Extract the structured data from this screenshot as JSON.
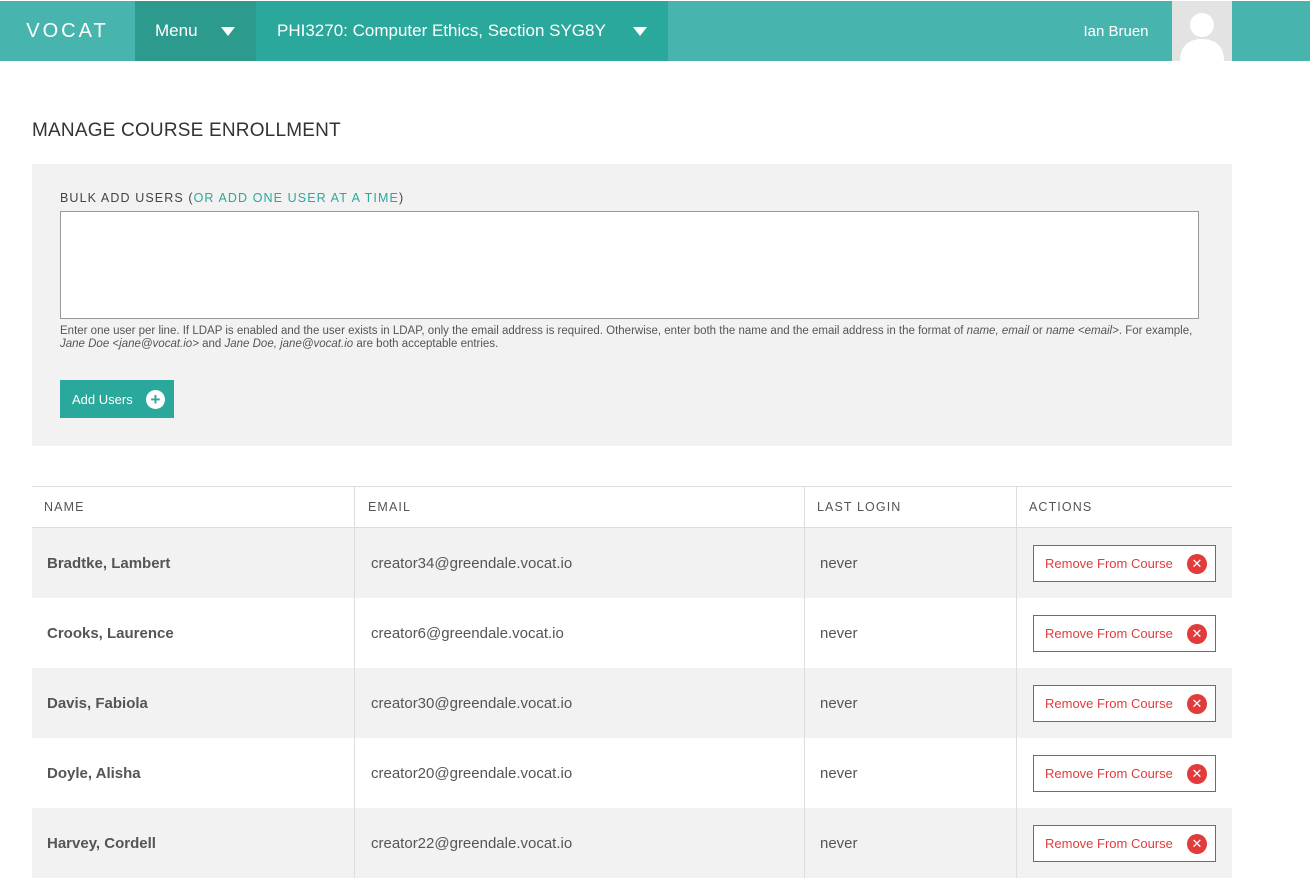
{
  "header": {
    "logo": "VOCAT",
    "menu_label": "Menu",
    "course_label": "PHI3270: Computer Ethics, Section SYG8Y",
    "user_name": "Ian Bruen"
  },
  "page": {
    "title": "MANAGE COURSE ENROLLMENT"
  },
  "bulk_add": {
    "label_prefix": "BULK ADD USERS (",
    "label_link": "OR ADD ONE USER AT A TIME",
    "label_suffix": ")",
    "textarea_value": "",
    "help_1": "Enter one user per line. If LDAP is enabled and the user exists in LDAP, only the email address is required. Otherwise, enter both the name and the email address in the format of ",
    "help_fmt_1": "name, email",
    "help_or": " or ",
    "help_fmt_2": "name <email>",
    "help_2": ". For example, ",
    "help_ex_1": "Jane Doe <jane@vocat.io>",
    "help_and": " and ",
    "help_ex_2": "Jane Doe, jane@vocat.io",
    "help_3": " are both acceptable entries.",
    "button_label": "Add Users"
  },
  "table": {
    "headers": {
      "name": "NAME",
      "email": "EMAIL",
      "last_login": "LAST LOGIN",
      "actions": "ACTIONS"
    },
    "action_label": "Remove From Course",
    "rows": [
      {
        "name": "Bradtke, Lambert",
        "email": "creator34@greendale.vocat.io",
        "last_login": "never"
      },
      {
        "name": "Crooks, Laurence",
        "email": "creator6@greendale.vocat.io",
        "last_login": "never"
      },
      {
        "name": "Davis, Fabiola",
        "email": "creator30@greendale.vocat.io",
        "last_login": "never"
      },
      {
        "name": "Doyle, Alisha",
        "email": "creator20@greendale.vocat.io",
        "last_login": "never"
      },
      {
        "name": "Harvey, Cordell",
        "email": "creator22@greendale.vocat.io",
        "last_login": "never"
      }
    ]
  },
  "colors": {
    "topbar": "#47b5ad",
    "accent": "#2aa89b",
    "danger": "#e23b3b"
  }
}
